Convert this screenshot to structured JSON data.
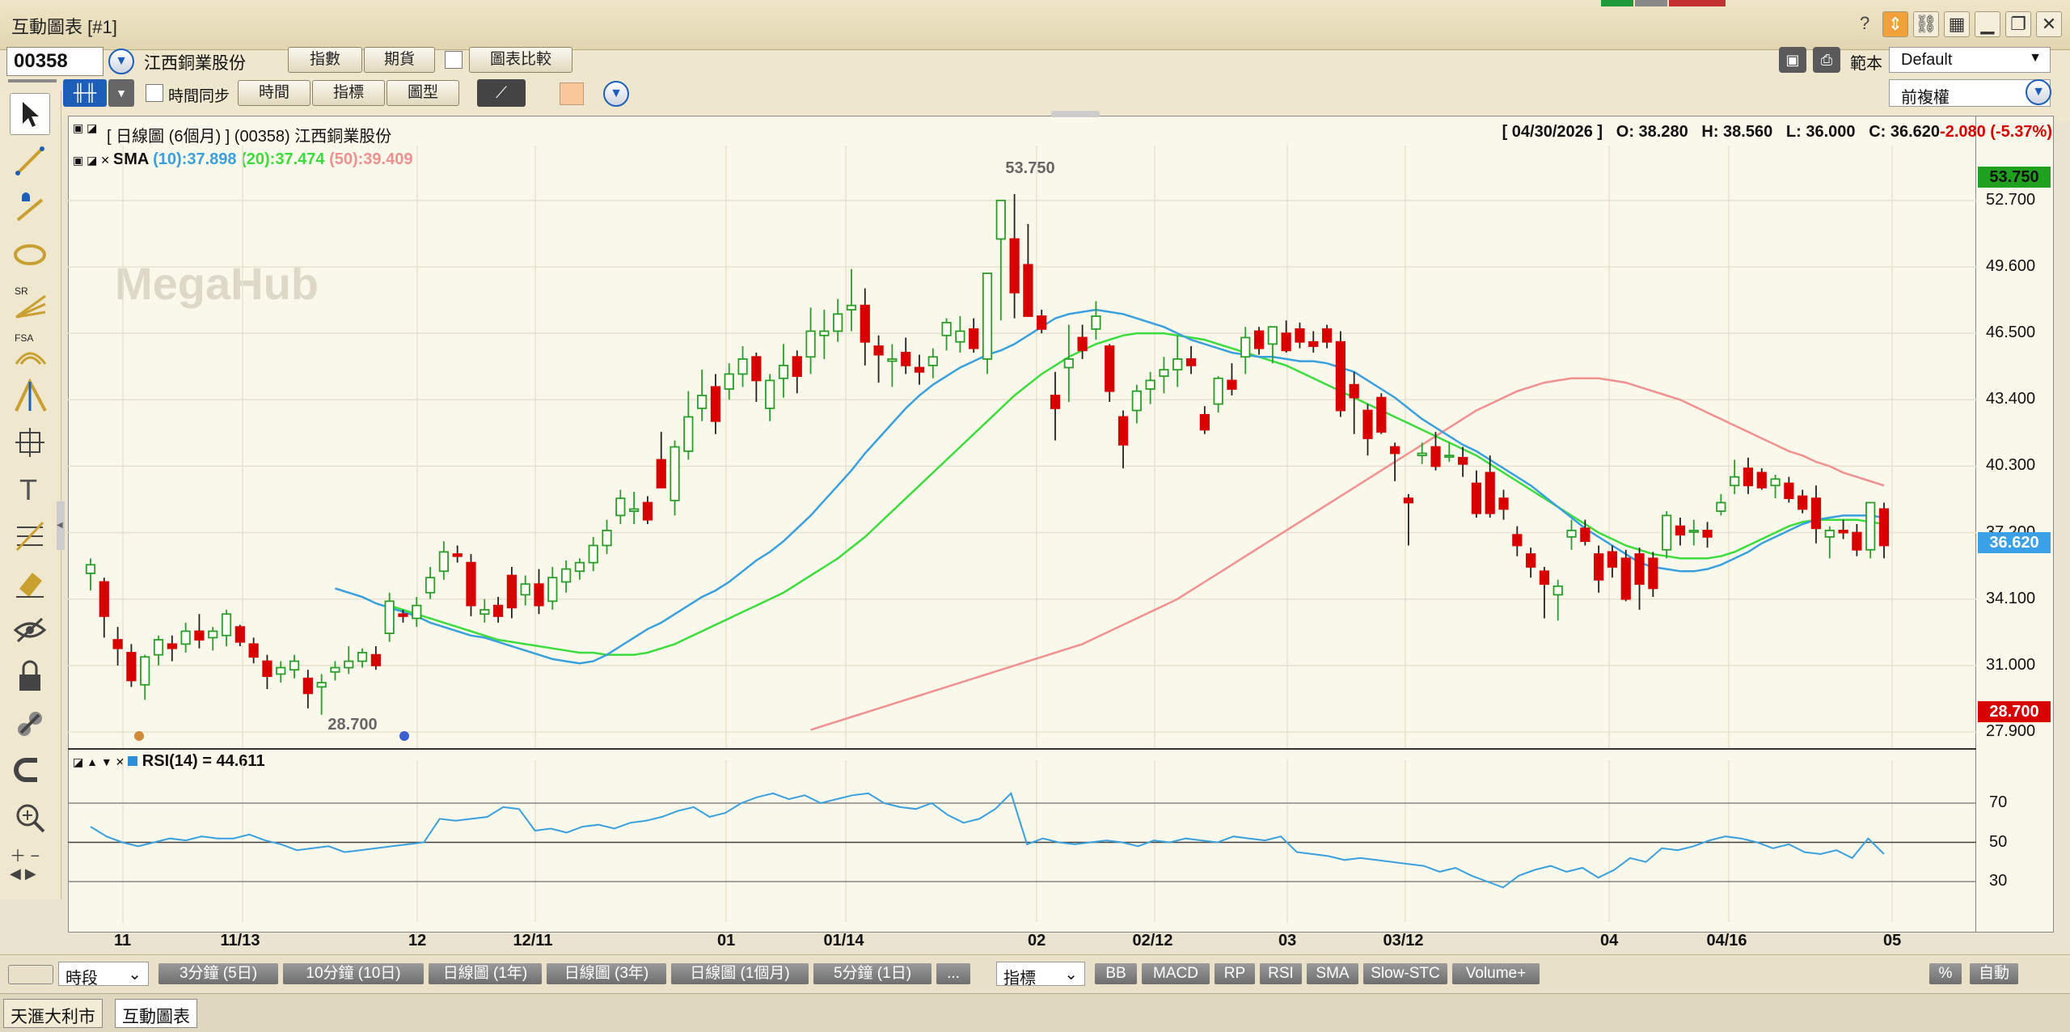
{
  "window": {
    "title": "互動圖表 [#1]",
    "help": "?"
  },
  "toolbar": {
    "stock_code": "00358",
    "stock_name": "江西銅業股份",
    "btn_index": "指數",
    "btn_futures": "期貨",
    "btn_compare": "圖表比較",
    "time_sync": "時間同步",
    "btn_time": "時間",
    "btn_indicator": "指標",
    "btn_chart_type": "圖型",
    "template_label": "範本",
    "template_value": "Default",
    "adjust_value": "前複權"
  },
  "chart_header": {
    "title": "[ 日線圖 (6個月) ]  (00358)  江西銅業股份",
    "date": "[ 04/30/2026 ]",
    "open": "O: 38.280",
    "high": "H: 38.560",
    "low": "L: 36.000",
    "close": "C: 36.620",
    "change": "-2.080 (-5.37%)"
  },
  "sma_legend": {
    "label": "SMA",
    "s10": "(10):37.898",
    "s20": "(20):37.474",
    "s50": "(50):39.409"
  },
  "rsi_legend": {
    "label": "RSI(14) = 44.611"
  },
  "watermark": "MegaHub",
  "annotations": {
    "high": "53.750",
    "low": "28.700"
  },
  "price_axis": [
    "52.700",
    "49.600",
    "46.500",
    "43.400",
    "40.300",
    "37.200",
    "34.100",
    "31.000",
    "27.900"
  ],
  "price_tags": {
    "high": "53.750",
    "last": "36.620",
    "low": "28.700"
  },
  "rsi_axis": [
    "70",
    "50",
    "30"
  ],
  "x_axis": [
    "11",
    "11/13",
    "12",
    "12/11",
    "01",
    "01/14",
    "02",
    "02/12",
    "03",
    "03/12",
    "04",
    "04/16",
    "05"
  ],
  "bottom": {
    "period_label": "時段",
    "periods": [
      "3分鐘 (5日)",
      "10分鐘 (10日)",
      "日線圖 (1年)",
      "日線圖 (3年)",
      "日線圖 (1個月)",
      "5分鐘 (1日)",
      "..."
    ],
    "indicator_label": "指標",
    "indicators": [
      "BB",
      "MACD",
      "RP",
      "RSI",
      "SMA",
      "Slow-STC",
      "Volume+"
    ],
    "percent": "%",
    "auto": "自動"
  },
  "taskbar": [
    "天滙大利市",
    "互動圖表"
  ],
  "colors": {
    "up": "#2a9d2a",
    "down": "#d80000",
    "sma10": "#3aa0dd",
    "sma20": "#3ddc3d",
    "sma50": "#f09090",
    "rsi": "#3aa0dd"
  },
  "chart_data": {
    "type": "candlestick",
    "ylim": [
      27.9,
      53.75
    ],
    "rsi_ylim": [
      0,
      100
    ],
    "candles": [
      {
        "o": 35.3,
        "h": 36.0,
        "l": 34.5,
        "c": 35.7
      },
      {
        "o": 34.9,
        "h": 35.1,
        "l": 32.3,
        "c": 33.3
      },
      {
        "o": 32.2,
        "h": 32.8,
        "l": 31.0,
        "c": 31.8
      },
      {
        "o": 31.6,
        "h": 32.0,
        "l": 30.0,
        "c": 30.3
      },
      {
        "o": 30.1,
        "h": 31.5,
        "l": 29.4,
        "c": 31.4
      },
      {
        "o": 31.5,
        "h": 32.4,
        "l": 31.0,
        "c": 32.2
      },
      {
        "o": 32.0,
        "h": 32.4,
        "l": 31.2,
        "c": 31.8
      },
      {
        "o": 32.0,
        "h": 33.0,
        "l": 31.6,
        "c": 32.6
      },
      {
        "o": 32.6,
        "h": 33.4,
        "l": 31.8,
        "c": 32.2
      },
      {
        "o": 32.3,
        "h": 32.8,
        "l": 31.7,
        "c": 32.6
      },
      {
        "o": 32.4,
        "h": 33.6,
        "l": 31.9,
        "c": 33.4
      },
      {
        "o": 32.8,
        "h": 32.9,
        "l": 31.9,
        "c": 32.1
      },
      {
        "o": 32.0,
        "h": 32.3,
        "l": 31.1,
        "c": 31.4
      },
      {
        "o": 31.2,
        "h": 31.5,
        "l": 29.9,
        "c": 30.5
      },
      {
        "o": 30.6,
        "h": 31.2,
        "l": 30.2,
        "c": 30.9
      },
      {
        "o": 30.8,
        "h": 31.5,
        "l": 30.4,
        "c": 31.2
      },
      {
        "o": 30.4,
        "h": 30.8,
        "l": 29.0,
        "c": 29.7
      },
      {
        "o": 30.0,
        "h": 30.6,
        "l": 28.7,
        "c": 30.2
      },
      {
        "o": 30.7,
        "h": 31.2,
        "l": 30.3,
        "c": 30.9
      },
      {
        "o": 30.9,
        "h": 31.9,
        "l": 30.6,
        "c": 31.2
      },
      {
        "o": 31.2,
        "h": 31.8,
        "l": 30.9,
        "c": 31.6
      },
      {
        "o": 31.5,
        "h": 31.9,
        "l": 30.8,
        "c": 31.0
      },
      {
        "o": 32.5,
        "h": 34.4,
        "l": 32.1,
        "c": 34.0
      },
      {
        "o": 33.4,
        "h": 33.6,
        "l": 33.0,
        "c": 33.3
      },
      {
        "o": 33.2,
        "h": 34.2,
        "l": 32.8,
        "c": 33.8
      },
      {
        "o": 34.4,
        "h": 35.6,
        "l": 34.1,
        "c": 35.1
      },
      {
        "o": 35.4,
        "h": 36.8,
        "l": 35.0,
        "c": 36.3
      },
      {
        "o": 36.2,
        "h": 36.6,
        "l": 35.8,
        "c": 36.1
      },
      {
        "o": 35.8,
        "h": 36.2,
        "l": 33.3,
        "c": 33.8
      },
      {
        "o": 33.4,
        "h": 34.1,
        "l": 33.0,
        "c": 33.6
      },
      {
        "o": 33.8,
        "h": 34.2,
        "l": 33.0,
        "c": 33.3
      },
      {
        "o": 35.2,
        "h": 35.6,
        "l": 33.2,
        "c": 33.7
      },
      {
        "o": 34.3,
        "h": 35.2,
        "l": 33.8,
        "c": 34.8
      },
      {
        "o": 34.8,
        "h": 35.5,
        "l": 33.4,
        "c": 33.8
      },
      {
        "o": 34.0,
        "h": 35.6,
        "l": 33.6,
        "c": 35.1
      },
      {
        "o": 34.9,
        "h": 35.9,
        "l": 34.4,
        "c": 35.5
      },
      {
        "o": 35.4,
        "h": 36.0,
        "l": 35.0,
        "c": 35.8
      },
      {
        "o": 35.8,
        "h": 37.0,
        "l": 35.4,
        "c": 36.6
      },
      {
        "o": 36.6,
        "h": 37.8,
        "l": 36.2,
        "c": 37.3
      },
      {
        "o": 38.0,
        "h": 39.2,
        "l": 37.6,
        "c": 38.8
      },
      {
        "o": 38.2,
        "h": 39.1,
        "l": 37.6,
        "c": 38.3
      },
      {
        "o": 38.6,
        "h": 38.9,
        "l": 37.6,
        "c": 37.8
      },
      {
        "o": 40.6,
        "h": 41.9,
        "l": 39.4,
        "c": 39.3
      },
      {
        "o": 38.7,
        "h": 41.5,
        "l": 38.0,
        "c": 41.2
      },
      {
        "o": 41.0,
        "h": 43.8,
        "l": 40.6,
        "c": 42.6
      },
      {
        "o": 43.0,
        "h": 44.8,
        "l": 42.4,
        "c": 43.6
      },
      {
        "o": 44.0,
        "h": 44.6,
        "l": 41.8,
        "c": 42.4
      },
      {
        "o": 43.9,
        "h": 45.1,
        "l": 43.4,
        "c": 44.6
      },
      {
        "o": 44.6,
        "h": 45.9,
        "l": 44.0,
        "c": 45.3
      },
      {
        "o": 45.4,
        "h": 45.6,
        "l": 43.3,
        "c": 44.3
      },
      {
        "o": 43.0,
        "h": 44.6,
        "l": 42.4,
        "c": 44.3
      },
      {
        "o": 44.4,
        "h": 46.0,
        "l": 43.5,
        "c": 45.0
      },
      {
        "o": 45.4,
        "h": 45.7,
        "l": 43.7,
        "c": 44.5
      },
      {
        "o": 45.4,
        "h": 47.7,
        "l": 44.6,
        "c": 46.6
      },
      {
        "o": 46.4,
        "h": 47.6,
        "l": 45.3,
        "c": 46.6
      },
      {
        "o": 46.6,
        "h": 48.1,
        "l": 46.1,
        "c": 47.4
      },
      {
        "o": 47.6,
        "h": 49.5,
        "l": 46.6,
        "c": 47.8
      },
      {
        "o": 47.8,
        "h": 48.6,
        "l": 45.0,
        "c": 46.1
      },
      {
        "o": 45.9,
        "h": 46.4,
        "l": 44.2,
        "c": 45.5
      },
      {
        "o": 45.2,
        "h": 46.0,
        "l": 44.0,
        "c": 45.3
      },
      {
        "o": 45.6,
        "h": 46.3,
        "l": 44.6,
        "c": 45.0
      },
      {
        "o": 44.9,
        "h": 45.5,
        "l": 44.1,
        "c": 44.7
      },
      {
        "o": 45.0,
        "h": 45.8,
        "l": 44.4,
        "c": 45.4
      },
      {
        "o": 46.4,
        "h": 47.2,
        "l": 45.7,
        "c": 47.0
      },
      {
        "o": 46.1,
        "h": 47.3,
        "l": 45.6,
        "c": 46.6
      },
      {
        "o": 46.7,
        "h": 47.2,
        "l": 45.6,
        "c": 45.8
      },
      {
        "o": 45.3,
        "h": 48.0,
        "l": 44.6,
        "c": 49.3
      },
      {
        "o": 50.9,
        "h": 52.7,
        "l": 47.1,
        "c": 52.7
      },
      {
        "o": 50.9,
        "h": 53.0,
        "l": 47.2,
        "c": 48.4
      },
      {
        "o": 49.7,
        "h": 51.6,
        "l": 47.3,
        "c": 47.3
      },
      {
        "o": 47.3,
        "h": 47.6,
        "l": 46.5,
        "c": 46.7
      },
      {
        "o": 43.6,
        "h": 44.7,
        "l": 41.5,
        "c": 43.0
      },
      {
        "o": 44.9,
        "h": 46.9,
        "l": 43.3,
        "c": 45.3
      },
      {
        "o": 46.3,
        "h": 46.9,
        "l": 45.3,
        "c": 45.7
      },
      {
        "o": 46.7,
        "h": 48.0,
        "l": 46.2,
        "c": 47.3
      },
      {
        "o": 45.9,
        "h": 46.0,
        "l": 43.3,
        "c": 43.8
      },
      {
        "o": 42.6,
        "h": 42.9,
        "l": 40.2,
        "c": 41.3
      },
      {
        "o": 42.9,
        "h": 44.1,
        "l": 42.3,
        "c": 43.8
      },
      {
        "o": 43.9,
        "h": 44.7,
        "l": 43.2,
        "c": 44.3
      },
      {
        "o": 44.5,
        "h": 45.4,
        "l": 43.7,
        "c": 44.8
      },
      {
        "o": 44.8,
        "h": 46.4,
        "l": 44.0,
        "c": 45.3
      },
      {
        "o": 45.3,
        "h": 45.9,
        "l": 44.6,
        "c": 45.0
      },
      {
        "o": 42.7,
        "h": 43.1,
        "l": 41.8,
        "c": 42.0
      },
      {
        "o": 43.2,
        "h": 44.5,
        "l": 42.8,
        "c": 44.4
      },
      {
        "o": 44.3,
        "h": 45.1,
        "l": 43.6,
        "c": 43.9
      },
      {
        "o": 45.4,
        "h": 46.8,
        "l": 44.6,
        "c": 46.3
      },
      {
        "o": 46.6,
        "h": 46.8,
        "l": 45.5,
        "c": 45.8
      },
      {
        "o": 46.0,
        "h": 46.8,
        "l": 45.1,
        "c": 46.8
      },
      {
        "o": 46.5,
        "h": 47.1,
        "l": 45.6,
        "c": 45.7
      },
      {
        "o": 46.7,
        "h": 47.0,
        "l": 45.8,
        "c": 46.1
      },
      {
        "o": 46.1,
        "h": 46.6,
        "l": 45.6,
        "c": 45.9
      },
      {
        "o": 46.7,
        "h": 46.9,
        "l": 45.8,
        "c": 46.1
      },
      {
        "o": 46.1,
        "h": 46.6,
        "l": 42.6,
        "c": 42.9
      },
      {
        "o": 44.1,
        "h": 44.7,
        "l": 41.8,
        "c": 43.5
      },
      {
        "o": 42.9,
        "h": 43.2,
        "l": 40.8,
        "c": 41.6
      },
      {
        "o": 43.5,
        "h": 43.7,
        "l": 41.8,
        "c": 41.9
      },
      {
        "o": 41.2,
        "h": 41.4,
        "l": 39.6,
        "c": 40.9
      },
      {
        "o": 38.8,
        "h": 39.0,
        "l": 36.6,
        "c": 38.6
      },
      {
        "o": 40.8,
        "h": 41.4,
        "l": 40.4,
        "c": 40.9
      },
      {
        "o": 41.2,
        "h": 41.9,
        "l": 40.1,
        "c": 40.3
      },
      {
        "o": 40.8,
        "h": 41.4,
        "l": 40.5,
        "c": 40.8
      },
      {
        "o": 40.7,
        "h": 41.2,
        "l": 39.8,
        "c": 40.4
      },
      {
        "o": 39.5,
        "h": 40.1,
        "l": 37.9,
        "c": 38.1
      },
      {
        "o": 40.0,
        "h": 40.8,
        "l": 37.9,
        "c": 38.1
      },
      {
        "o": 38.8,
        "h": 39.2,
        "l": 37.8,
        "c": 38.3
      },
      {
        "o": 37.1,
        "h": 37.5,
        "l": 36.1,
        "c": 36.6
      },
      {
        "o": 36.2,
        "h": 36.5,
        "l": 35.1,
        "c": 35.6
      },
      {
        "o": 35.4,
        "h": 35.6,
        "l": 33.2,
        "c": 34.8
      },
      {
        "o": 34.3,
        "h": 35.0,
        "l": 33.1,
        "c": 34.7
      },
      {
        "o": 37.0,
        "h": 37.8,
        "l": 36.4,
        "c": 37.3
      },
      {
        "o": 37.4,
        "h": 37.8,
        "l": 36.6,
        "c": 36.8
      },
      {
        "o": 36.2,
        "h": 36.6,
        "l": 34.4,
        "c": 35.0
      },
      {
        "o": 36.3,
        "h": 36.6,
        "l": 35.1,
        "c": 35.6
      },
      {
        "o": 36.0,
        "h": 36.4,
        "l": 34.0,
        "c": 34.1
      },
      {
        "o": 36.2,
        "h": 36.5,
        "l": 33.6,
        "c": 34.8
      },
      {
        "o": 36.0,
        "h": 36.3,
        "l": 34.2,
        "c": 34.6
      },
      {
        "o": 36.4,
        "h": 38.2,
        "l": 36.0,
        "c": 38.0
      },
      {
        "o": 37.5,
        "h": 37.9,
        "l": 36.6,
        "c": 37.1
      },
      {
        "o": 37.3,
        "h": 37.8,
        "l": 36.6,
        "c": 37.3
      },
      {
        "o": 37.3,
        "h": 37.7,
        "l": 36.5,
        "c": 37.0
      },
      {
        "o": 38.2,
        "h": 39.0,
        "l": 38.0,
        "c": 38.6
      },
      {
        "o": 39.4,
        "h": 40.6,
        "l": 39.0,
        "c": 39.8
      },
      {
        "o": 40.2,
        "h": 40.7,
        "l": 39.0,
        "c": 39.4
      },
      {
        "o": 40.0,
        "h": 40.2,
        "l": 39.2,
        "c": 39.3
      },
      {
        "o": 39.4,
        "h": 39.9,
        "l": 38.8,
        "c": 39.7
      },
      {
        "o": 39.5,
        "h": 39.8,
        "l": 38.6,
        "c": 38.8
      },
      {
        "o": 38.9,
        "h": 39.2,
        "l": 38.1,
        "c": 38.3
      },
      {
        "o": 38.8,
        "h": 39.4,
        "l": 36.7,
        "c": 37.4
      },
      {
        "o": 37.0,
        "h": 37.5,
        "l": 36.0,
        "c": 37.3
      },
      {
        "o": 37.3,
        "h": 37.8,
        "l": 36.9,
        "c": 37.2
      },
      {
        "o": 37.2,
        "h": 37.6,
        "l": 36.1,
        "c": 36.4
      },
      {
        "o": 36.4,
        "h": 38.6,
        "l": 36.0,
        "c": 38.6
      },
      {
        "o": 38.3,
        "h": 38.6,
        "l": 36.0,
        "c": 36.6
      }
    ],
    "sma10": [
      34.6,
      34.4,
      34.2,
      33.9,
      33.7,
      33.5,
      33.3,
      33.0,
      32.8,
      32.6,
      32.4,
      32.3,
      32.1,
      31.9,
      31.7,
      31.5,
      31.3,
      31.2,
      31.1,
      31.2,
      31.5,
      31.9,
      32.3,
      32.7,
      33.0,
      33.4,
      33.8,
      34.2,
      34.5,
      34.9,
      35.4,
      35.9,
      36.3,
      36.8,
      37.4,
      38.0,
      38.7,
      39.4,
      40.1,
      40.9,
      41.6,
      42.3,
      43.0,
      43.6,
      44.1,
      44.5,
      44.9,
      45.2,
      45.5,
      45.7,
      46.0,
      46.4,
      46.8,
      47.2,
      47.4,
      47.5,
      47.6,
      47.5,
      47.4,
      47.2,
      47.0,
      46.8,
      46.5,
      46.2,
      46.0,
      45.8,
      45.6,
      45.5,
      45.4,
      45.4,
      45.3,
      45.2,
      45.2,
      45.1,
      44.9,
      44.7,
      44.3,
      43.9,
      43.5,
      43.0,
      42.5,
      42.1,
      41.7,
      41.3,
      41.0,
      40.6,
      40.2,
      39.8,
      39.4,
      38.9,
      38.4,
      37.9,
      37.4,
      37.0,
      36.6,
      36.2,
      35.8,
      35.6,
      35.5,
      35.4,
      35.4,
      35.5,
      35.7,
      36.0,
      36.3,
      36.7,
      37.0,
      37.3,
      37.6,
      37.8,
      37.9,
      38.0,
      38.0,
      38.0,
      37.9
    ],
    "sma20": [
      33.8,
      33.6,
      33.4,
      33.2,
      33.0,
      32.8,
      32.6,
      32.4,
      32.2,
      32.1,
      32.0,
      31.9,
      31.8,
      31.7,
      31.6,
      31.6,
      31.5,
      31.5,
      31.5,
      31.6,
      31.8,
      32.0,
      32.3,
      32.6,
      32.9,
      33.2,
      33.5,
      33.8,
      34.1,
      34.4,
      34.8,
      35.2,
      35.6,
      36.0,
      36.5,
      37.0,
      37.6,
      38.2,
      38.8,
      39.4,
      40.0,
      40.6,
      41.2,
      41.8,
      42.4,
      43.0,
      43.6,
      44.1,
      44.6,
      45.0,
      45.4,
      45.7,
      46.0,
      46.2,
      46.4,
      46.5,
      46.5,
      46.5,
      46.4,
      46.3,
      46.2,
      46.0,
      45.8,
      45.6,
      45.4,
      45.2,
      45.0,
      44.7,
      44.4,
      44.1,
      43.8,
      43.5,
      43.2,
      42.9,
      42.6,
      42.3,
      42.0,
      41.7,
      41.4,
      41.1,
      40.8,
      40.4,
      40.0,
      39.6,
      39.2,
      38.8,
      38.4,
      38.0,
      37.6,
      37.2,
      36.9,
      36.6,
      36.4,
      36.2,
      36.1,
      36.0,
      36.0,
      36.0,
      36.1,
      36.3,
      36.6,
      36.9,
      37.2,
      37.5,
      37.7,
      37.8,
      37.8,
      37.8,
      37.8,
      37.7,
      37.6
    ],
    "sma50": [
      28.0,
      28.2,
      28.4,
      28.6,
      28.8,
      29.0,
      29.2,
      29.4,
      29.6,
      29.8,
      30.0,
      30.2,
      30.4,
      30.6,
      30.8,
      31.0,
      31.2,
      31.4,
      31.6,
      31.8,
      32.0,
      32.3,
      32.6,
      32.9,
      33.2,
      33.5,
      33.8,
      34.1,
      34.5,
      34.9,
      35.3,
      35.7,
      36.1,
      36.5,
      36.9,
      37.3,
      37.7,
      38.1,
      38.5,
      38.9,
      39.3,
      39.7,
      40.1,
      40.5,
      40.9,
      41.3,
      41.7,
      42.1,
      42.5,
      42.9,
      43.2,
      43.5,
      43.8,
      44.0,
      44.2,
      44.3,
      44.4,
      44.4,
      44.4,
      44.3,
      44.2,
      44.0,
      43.8,
      43.6,
      43.4,
      43.1,
      42.8,
      42.5,
      42.2,
      41.9,
      41.6,
      41.3,
      41.0,
      40.8,
      40.5,
      40.3,
      40.0,
      39.8,
      39.6,
      39.4
    ],
    "rsi": [
      58,
      53,
      50,
      48,
      50,
      52,
      51,
      53,
      52,
      52,
      54,
      51,
      49,
      46,
      47,
      48,
      45,
      46,
      47,
      48,
      49,
      50,
      62,
      61,
      62,
      63,
      68,
      67,
      56,
      57,
      55,
      58,
      59,
      57,
      60,
      61,
      63,
      66,
      68,
      63,
      65,
      70,
      73,
      75,
      72,
      74,
      70,
      72,
      74,
      75,
      70,
      68,
      67,
      70,
      64,
      60,
      62,
      67,
      75,
      49,
      52,
      50,
      49,
      50,
      51,
      50,
      48,
      51,
      50,
      52,
      51,
      50,
      53,
      52,
      51,
      53,
      45,
      44,
      43,
      41,
      42,
      41,
      40,
      39,
      38,
      35,
      37,
      33,
      30,
      27,
      33,
      36,
      38,
      35,
      37,
      32,
      36,
      42,
      40,
      47,
      46,
      48,
      51,
      53,
      52,
      50,
      47,
      49,
      45,
      44,
      46,
      42,
      52,
      44
    ]
  }
}
